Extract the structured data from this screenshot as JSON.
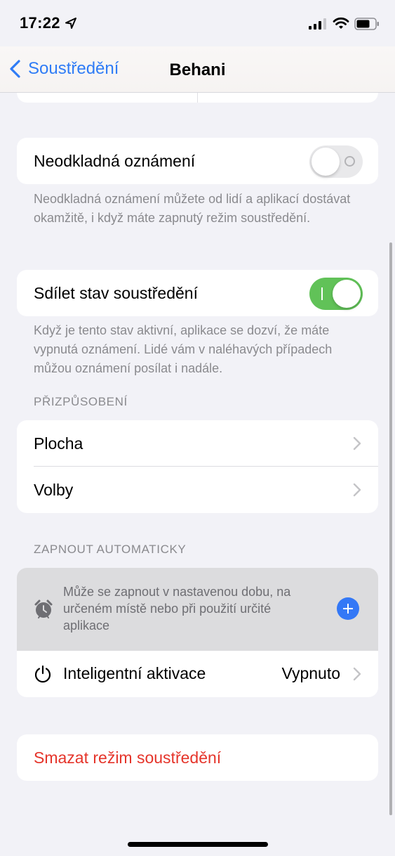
{
  "status_bar": {
    "time": "17:22"
  },
  "nav": {
    "back_label": "Soustředění",
    "title": "Behani"
  },
  "breakthrough": {
    "label": "Neodkladná oznámení",
    "enabled": false,
    "footer": "Neodkladná oznámení můžete od lidí a aplikací dostávat okamžitě, i když máte zapnutý režim soustředění."
  },
  "share_status": {
    "label": "Sdílet stav soustředění",
    "enabled": true,
    "footer": "Když je tento stav aktivní, aplikace se dozví, že máte vypnutá oznámení. Lidé vám v naléhavých případech můžou oznámení posílat i nadále."
  },
  "customize": {
    "header": "PŘIZPŮSOBENÍ",
    "items": [
      {
        "label": "Plocha"
      },
      {
        "label": "Volby"
      }
    ]
  },
  "auto_on": {
    "header": "ZAPNOUT AUTOMATICKY",
    "hint": "Může se zapnout v nastavenou dobu, na určeném místě nebo při použití určité aplikace",
    "smart_label": "Inteligentní aktivace",
    "smart_value": "Vypnuto"
  },
  "delete": {
    "label": "Smazat režim soustředění"
  },
  "colors": {
    "accent": "#2f7cf6",
    "toggle_on": "#61c258",
    "destructive": "#e5342a",
    "background": "#f2f2f7"
  }
}
